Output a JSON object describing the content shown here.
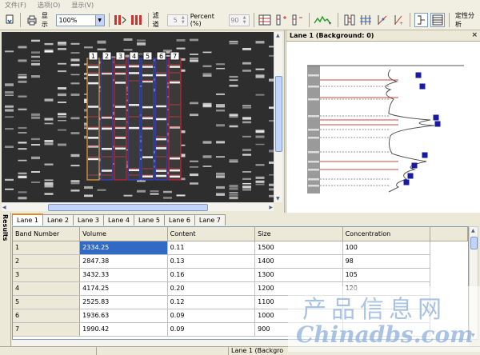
{
  "menu": [
    "文件(F)",
    "选项(O)",
    "显示(V)"
  ],
  "toolbar": {
    "display_label": "显示",
    "zoom_value": "100%",
    "filter_label": "滤道",
    "filter_value": "5",
    "percent_label": "Percent (%)",
    "percent_value": "90",
    "analysis_label": "定性分析"
  },
  "gel": {
    "lane_numbers": [
      "1",
      "2",
      "3",
      "4",
      "5",
      "6",
      "7"
    ]
  },
  "lane_profile": {
    "title": "Lane 1 (Background:  0)"
  },
  "results": {
    "side_label": "Results",
    "tabs": [
      "Lane 1",
      "Lane 2",
      "Lane 3",
      "Lane 4",
      "Lane 5",
      "Lane 6",
      "Lane 7"
    ],
    "active_tab": 0,
    "columns": [
      "Band Number",
      "Volume",
      "Content",
      "Size",
      "Concentration"
    ],
    "rows": [
      [
        "1",
        "2334.25",
        "0.11",
        "1500",
        "100"
      ],
      [
        "2",
        "2847.38",
        "0.13",
        "1400",
        "98"
      ],
      [
        "3",
        "3432.33",
        "0.16",
        "1300",
        "105"
      ],
      [
        "4",
        "4174.25",
        "0.20",
        "1200",
        "120"
      ],
      [
        "5",
        "2525.83",
        "0.12",
        "1100",
        ""
      ],
      [
        "6",
        "1936.63",
        "0.09",
        "1000",
        ""
      ],
      [
        "7",
        "1990.42",
        "0.09",
        "900",
        ""
      ]
    ]
  },
  "status": {
    "lane_text": "Lane 1 (Backgro"
  },
  "watermark": {
    "cn": "产品信息网",
    "en": "Chinadbs.com"
  },
  "colors": {
    "lane_box_selected": "#e8a040",
    "lane_box_blue": "#3344cc",
    "lane_box_red": "#cc2233",
    "selected_cell": "#316ac5",
    "marker": "#1a1aa0"
  }
}
